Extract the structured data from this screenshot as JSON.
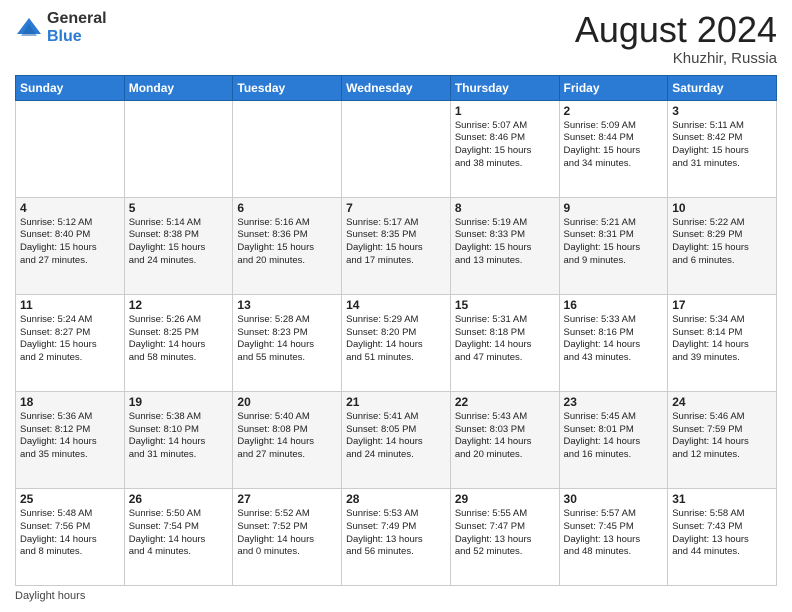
{
  "header": {
    "logo_general": "General",
    "logo_blue": "Blue",
    "month_title": "August 2024",
    "location": "Khuzhir, Russia"
  },
  "weekdays": [
    "Sunday",
    "Monday",
    "Tuesday",
    "Wednesday",
    "Thursday",
    "Friday",
    "Saturday"
  ],
  "weeks": [
    [
      {
        "day": "",
        "info": ""
      },
      {
        "day": "",
        "info": ""
      },
      {
        "day": "",
        "info": ""
      },
      {
        "day": "",
        "info": ""
      },
      {
        "day": "1",
        "info": "Sunrise: 5:07 AM\nSunset: 8:46 PM\nDaylight: 15 hours\nand 38 minutes."
      },
      {
        "day": "2",
        "info": "Sunrise: 5:09 AM\nSunset: 8:44 PM\nDaylight: 15 hours\nand 34 minutes."
      },
      {
        "day": "3",
        "info": "Sunrise: 5:11 AM\nSunset: 8:42 PM\nDaylight: 15 hours\nand 31 minutes."
      }
    ],
    [
      {
        "day": "4",
        "info": "Sunrise: 5:12 AM\nSunset: 8:40 PM\nDaylight: 15 hours\nand 27 minutes."
      },
      {
        "day": "5",
        "info": "Sunrise: 5:14 AM\nSunset: 8:38 PM\nDaylight: 15 hours\nand 24 minutes."
      },
      {
        "day": "6",
        "info": "Sunrise: 5:16 AM\nSunset: 8:36 PM\nDaylight: 15 hours\nand 20 minutes."
      },
      {
        "day": "7",
        "info": "Sunrise: 5:17 AM\nSunset: 8:35 PM\nDaylight: 15 hours\nand 17 minutes."
      },
      {
        "day": "8",
        "info": "Sunrise: 5:19 AM\nSunset: 8:33 PM\nDaylight: 15 hours\nand 13 minutes."
      },
      {
        "day": "9",
        "info": "Sunrise: 5:21 AM\nSunset: 8:31 PM\nDaylight: 15 hours\nand 9 minutes."
      },
      {
        "day": "10",
        "info": "Sunrise: 5:22 AM\nSunset: 8:29 PM\nDaylight: 15 hours\nand 6 minutes."
      }
    ],
    [
      {
        "day": "11",
        "info": "Sunrise: 5:24 AM\nSunset: 8:27 PM\nDaylight: 15 hours\nand 2 minutes."
      },
      {
        "day": "12",
        "info": "Sunrise: 5:26 AM\nSunset: 8:25 PM\nDaylight: 14 hours\nand 58 minutes."
      },
      {
        "day": "13",
        "info": "Sunrise: 5:28 AM\nSunset: 8:23 PM\nDaylight: 14 hours\nand 55 minutes."
      },
      {
        "day": "14",
        "info": "Sunrise: 5:29 AM\nSunset: 8:20 PM\nDaylight: 14 hours\nand 51 minutes."
      },
      {
        "day": "15",
        "info": "Sunrise: 5:31 AM\nSunset: 8:18 PM\nDaylight: 14 hours\nand 47 minutes."
      },
      {
        "day": "16",
        "info": "Sunrise: 5:33 AM\nSunset: 8:16 PM\nDaylight: 14 hours\nand 43 minutes."
      },
      {
        "day": "17",
        "info": "Sunrise: 5:34 AM\nSunset: 8:14 PM\nDaylight: 14 hours\nand 39 minutes."
      }
    ],
    [
      {
        "day": "18",
        "info": "Sunrise: 5:36 AM\nSunset: 8:12 PM\nDaylight: 14 hours\nand 35 minutes."
      },
      {
        "day": "19",
        "info": "Sunrise: 5:38 AM\nSunset: 8:10 PM\nDaylight: 14 hours\nand 31 minutes."
      },
      {
        "day": "20",
        "info": "Sunrise: 5:40 AM\nSunset: 8:08 PM\nDaylight: 14 hours\nand 27 minutes."
      },
      {
        "day": "21",
        "info": "Sunrise: 5:41 AM\nSunset: 8:05 PM\nDaylight: 14 hours\nand 24 minutes."
      },
      {
        "day": "22",
        "info": "Sunrise: 5:43 AM\nSunset: 8:03 PM\nDaylight: 14 hours\nand 20 minutes."
      },
      {
        "day": "23",
        "info": "Sunrise: 5:45 AM\nSunset: 8:01 PM\nDaylight: 14 hours\nand 16 minutes."
      },
      {
        "day": "24",
        "info": "Sunrise: 5:46 AM\nSunset: 7:59 PM\nDaylight: 14 hours\nand 12 minutes."
      }
    ],
    [
      {
        "day": "25",
        "info": "Sunrise: 5:48 AM\nSunset: 7:56 PM\nDaylight: 14 hours\nand 8 minutes."
      },
      {
        "day": "26",
        "info": "Sunrise: 5:50 AM\nSunset: 7:54 PM\nDaylight: 14 hours\nand 4 minutes."
      },
      {
        "day": "27",
        "info": "Sunrise: 5:52 AM\nSunset: 7:52 PM\nDaylight: 14 hours\nand 0 minutes."
      },
      {
        "day": "28",
        "info": "Sunrise: 5:53 AM\nSunset: 7:49 PM\nDaylight: 13 hours\nand 56 minutes."
      },
      {
        "day": "29",
        "info": "Sunrise: 5:55 AM\nSunset: 7:47 PM\nDaylight: 13 hours\nand 52 minutes."
      },
      {
        "day": "30",
        "info": "Sunrise: 5:57 AM\nSunset: 7:45 PM\nDaylight: 13 hours\nand 48 minutes."
      },
      {
        "day": "31",
        "info": "Sunrise: 5:58 AM\nSunset: 7:43 PM\nDaylight: 13 hours\nand 44 minutes."
      }
    ]
  ],
  "footer": {
    "note": "Daylight hours"
  }
}
